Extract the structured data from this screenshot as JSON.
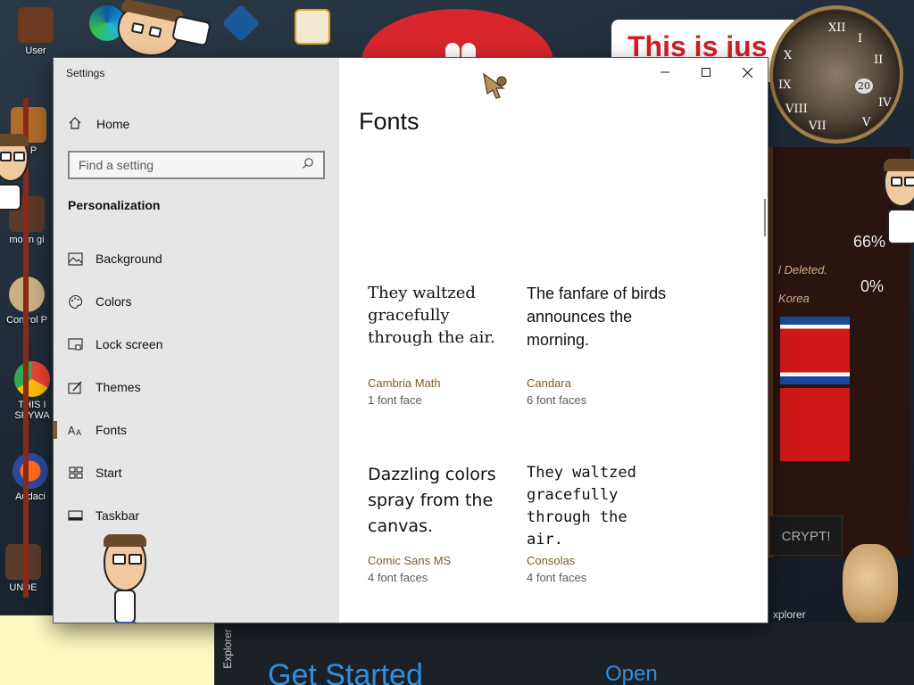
{
  "desktop": {
    "icons": [
      {
        "label": "User",
        "color": "#6b3a20"
      },
      {
        "label": "is P",
        "color": "#b06a2a"
      },
      {
        "label": "moon gi",
        "color": "#5a3a2a"
      },
      {
        "label": "Control P",
        "color": "#c8b080"
      },
      {
        "label": "THIS I SPYWA",
        "color": "#4285f4"
      },
      {
        "label": "Audaci",
        "color": "#ff6b1a"
      },
      {
        "label": "UNDE",
        "color": "#5a3a2a"
      }
    ],
    "ransom_headline": "This is jus",
    "ransom_panel": {
      "deleted_text": "l Deleted.",
      "korea_text": "Korea",
      "percent_top": "66%",
      "percent_bottom": "0%",
      "decrypt_label": "CRYPT!"
    },
    "clock_numerals": [
      "XII",
      "I",
      "II",
      "X",
      "IX",
      "VIII",
      "VII",
      "V",
      "IV"
    ],
    "clock_date": "20",
    "explorer_tab": "Explorer",
    "explorer_label": "xplorer",
    "get_started": "Get Started",
    "open_link": "Open"
  },
  "window": {
    "title": "Settings",
    "buttons": {
      "minimize": "minimize",
      "maximize": "maximize",
      "close": "close"
    }
  },
  "sidebar": {
    "home_label": "Home",
    "search_placeholder": "Find a setting",
    "section_title": "Personalization",
    "items": [
      {
        "label": "Background",
        "icon": "image-icon"
      },
      {
        "label": "Colors",
        "icon": "palette-icon"
      },
      {
        "label": "Lock screen",
        "icon": "lock-screen-icon"
      },
      {
        "label": "Themes",
        "icon": "themes-icon"
      },
      {
        "label": "Fonts",
        "icon": "fonts-icon",
        "active": true
      },
      {
        "label": "Start",
        "icon": "start-icon"
      },
      {
        "label": "Taskbar",
        "icon": "taskbar-icon"
      }
    ]
  },
  "main": {
    "page_title": "Fonts",
    "fonts": [
      {
        "sample": "They waltzed gracefully through the air.",
        "name": "Cambria Math",
        "faces": "1 font face"
      },
      {
        "sample": "The fanfare of birds announces the morning.",
        "name": "Candara",
        "faces": "6 font faces"
      },
      {
        "sample": "Dazzling colors spray from the canvas.",
        "name": "Comic Sans MS",
        "faces": "4 font faces"
      },
      {
        "sample": "They waltzed gracefully through the air.",
        "name": "Consolas",
        "faces": "4 font faces"
      }
    ]
  },
  "colors": {
    "accent": "#7a5c2c",
    "sidebar_bg": "#e6e6e6"
  }
}
